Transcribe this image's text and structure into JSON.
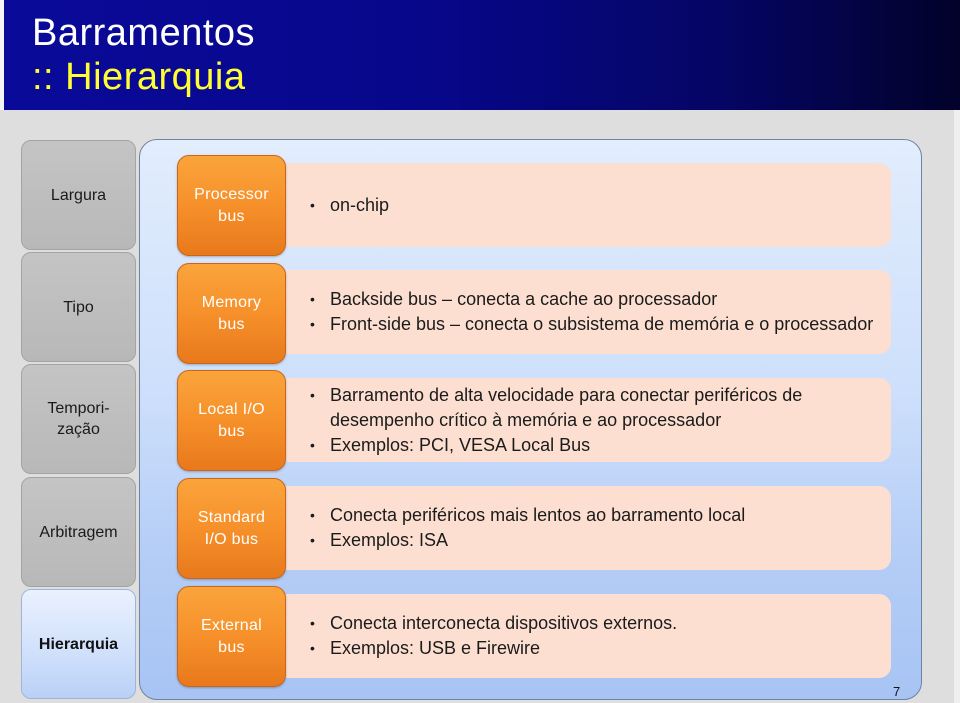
{
  "title": {
    "line1": "Barramentos",
    "line2": ":: Hierarquia"
  },
  "tabs": [
    {
      "label": "Largura",
      "active": false
    },
    {
      "label": "Tipo",
      "active": false
    },
    {
      "label": "Tempori-\nzação",
      "active": false
    },
    {
      "label": "Arbitragem",
      "active": false
    },
    {
      "label": "Hierarquia",
      "active": true
    }
  ],
  "rows": [
    {
      "bus": "Processor\nbus",
      "bullets": [
        "on-chip"
      ]
    },
    {
      "bus": "Memory\nbus",
      "bullets": [
        "Backside bus – conecta a cache ao processador",
        "Front-side bus – conecta o subsistema de memória e o processador"
      ]
    },
    {
      "bus": "Local I/O\nbus",
      "bullets": [
        "Barramento de alta velocidade para conectar periféricos de desempenho crítico à memória e ao processador",
        "Exemplos: PCI, VESA Local Bus"
      ]
    },
    {
      "bus": "Standard\nI/O bus",
      "bullets": [
        "Conecta periféricos mais lentos ao barramento local",
        "Exemplos: ISA"
      ]
    },
    {
      "bus": "External\nbus",
      "bullets": [
        "Conecta interconecta dispositivos externos.",
        "Exemplos: USB e Firewire"
      ]
    }
  ],
  "bullet_glyph": "•",
  "page_number": "7",
  "colors": {
    "title_bg": "#07078a",
    "title_line1": "#ffffff",
    "title_line2": "#ffff33",
    "bus_box": "#f6902a",
    "description_box": "#fcdfd1",
    "tab_inactive": "#bebebe",
    "tab_active": "#cfe0fb"
  }
}
